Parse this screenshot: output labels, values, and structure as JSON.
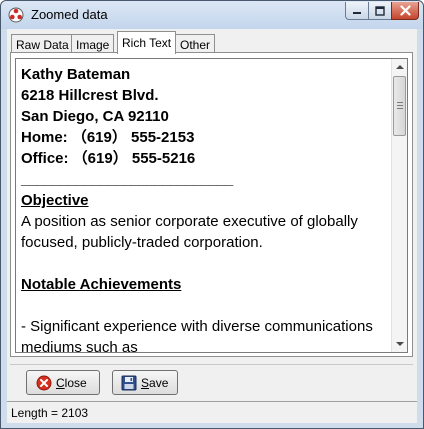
{
  "window": {
    "title": "Zoomed data",
    "controls": {
      "minimize_icon": "minimize-icon",
      "maximize_icon": "maximize-icon",
      "close_icon": "close-icon"
    }
  },
  "tabs": [
    {
      "label": "Raw Data",
      "active": false
    },
    {
      "label": "Image",
      "active": false
    },
    {
      "label": "Rich Text",
      "active": true
    },
    {
      "label": "Other",
      "active": false
    }
  ],
  "document": {
    "contact": [
      "Kathy Bateman",
      "6218 Hillcrest Blvd.",
      "San Diego, CA 92110",
      "Home:  （619）  555-2153",
      "Office: （619）  555-5216"
    ],
    "rule": "___________________________",
    "objective_heading": "Objective",
    "objective_text": "A position as senior corporate executive of globally focused, publicly-traded corporation.",
    "achievements_heading": "Notable Achievements",
    "achievement_1": "- Significant experience with diverse communications mediums such as"
  },
  "buttons": {
    "close": {
      "label_first": "C",
      "label_rest": "lose",
      "icon": "close-circle-icon"
    },
    "save": {
      "label_first": "S",
      "label_rest": "ave",
      "icon": "floppy-disk-icon"
    }
  },
  "status": {
    "text": "Length = 2103"
  },
  "colors": {
    "title_bar": "#c3d5ec",
    "close_button": "#c5452c",
    "client": "#f0f0f0"
  }
}
